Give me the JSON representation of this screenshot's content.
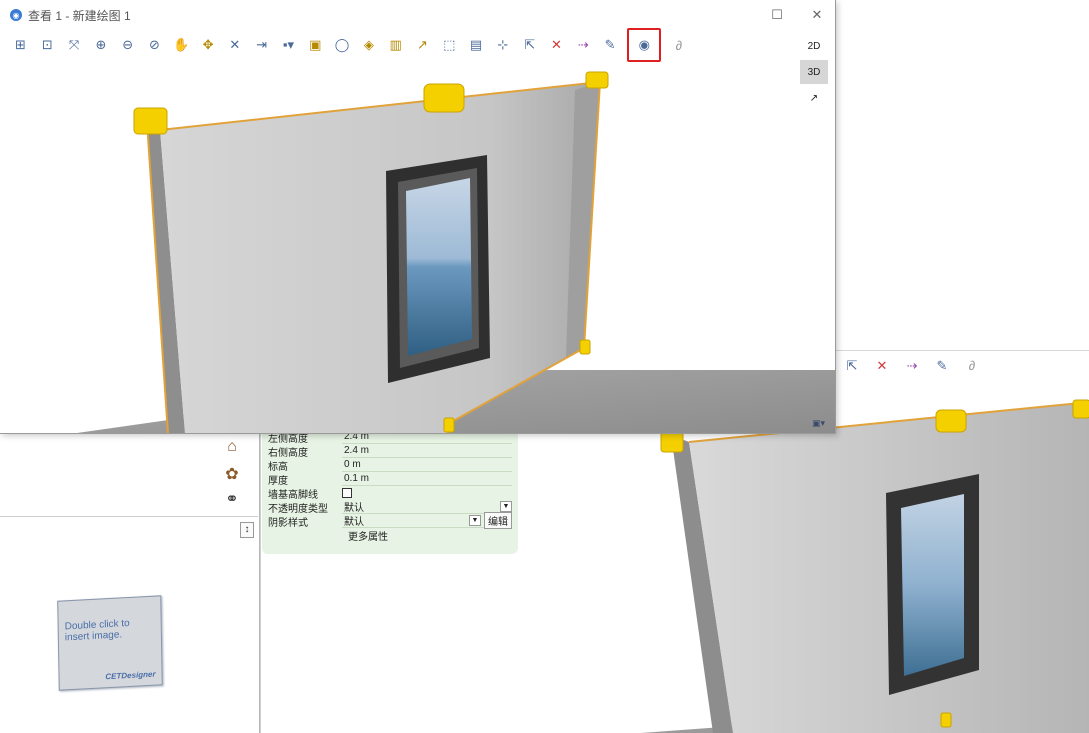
{
  "window": {
    "title": "查看 1 - 新建绘图 1",
    "controls": {
      "maximize": "☐",
      "close": "✕"
    },
    "toolbar": [
      "zoom-extents-icon",
      "zoom-window-icon",
      "zoom-fit-icon",
      "zoom-in-icon",
      "zoom-out-icon",
      "zoom-previous-icon",
      "pan-hand-icon",
      "orbit-icon",
      "fit-selection-icon",
      "walk-icon",
      "camera-icon",
      "render-icon",
      "xray-icon",
      "hide-icon",
      "section-icon",
      "measure-icon",
      "select-icon",
      "comment-icon",
      "insert-point-icon",
      "move-icon",
      "delete-icon",
      "stretch-icon",
      "pencil-icon",
      "screenshot-icon",
      "unlink-icon"
    ],
    "view_buttons": {
      "two_d": "2D",
      "three_d": "3D",
      "export": "↗"
    }
  },
  "properties": {
    "rows": [
      {
        "label": "左侧高度",
        "value": "2.4 m"
      },
      {
        "label": "右侧高度",
        "value": "2.4 m"
      },
      {
        "label": "标高",
        "value": "0 m"
      },
      {
        "label": "厚度",
        "value": "0.1 m"
      }
    ],
    "baseline_label": "墙基高脚线",
    "opacity_label": "不透明度类型",
    "opacity_value": "默认",
    "shadow_label": "阴影样式",
    "shadow_value": "默认",
    "edit_label": "编辑",
    "more_label": "更多属性"
  },
  "image_card": {
    "text": "Double click to insert image.",
    "brand": "CETDesigner"
  },
  "colors": {
    "accent_highlight": "#e02020",
    "wall": "#c5c5c5",
    "gizmo": "#f5d000",
    "props_bg": "#e7f3e4"
  }
}
